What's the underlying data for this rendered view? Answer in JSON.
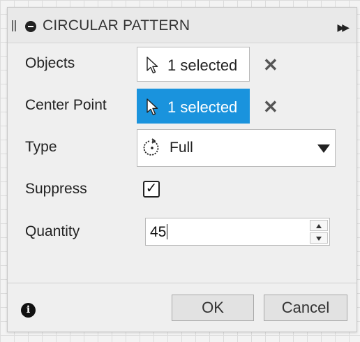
{
  "dialog": {
    "title": "CIRCULAR PATTERN",
    "icons": {
      "grip": "drag-grip-icon",
      "collapse": "collapse-icon",
      "expand": "expand-arrows-icon"
    }
  },
  "fields": {
    "objects": {
      "label": "Objects",
      "value": "1 selected",
      "active": false
    },
    "center_point": {
      "label": "Center Point",
      "value": "1 selected",
      "active": true
    },
    "type": {
      "label": "Type",
      "value": "Full",
      "icon": "full-circle-arrow-icon"
    },
    "suppress": {
      "label": "Suppress",
      "checked": true,
      "mark": "✓"
    },
    "quantity": {
      "label": "Quantity",
      "value": "45"
    }
  },
  "footer": {
    "info_glyph": "i",
    "ok_label": "OK",
    "cancel_label": "Cancel"
  },
  "colors": {
    "accent": "#1a93dd",
    "dialog_bg": "#efefef"
  }
}
